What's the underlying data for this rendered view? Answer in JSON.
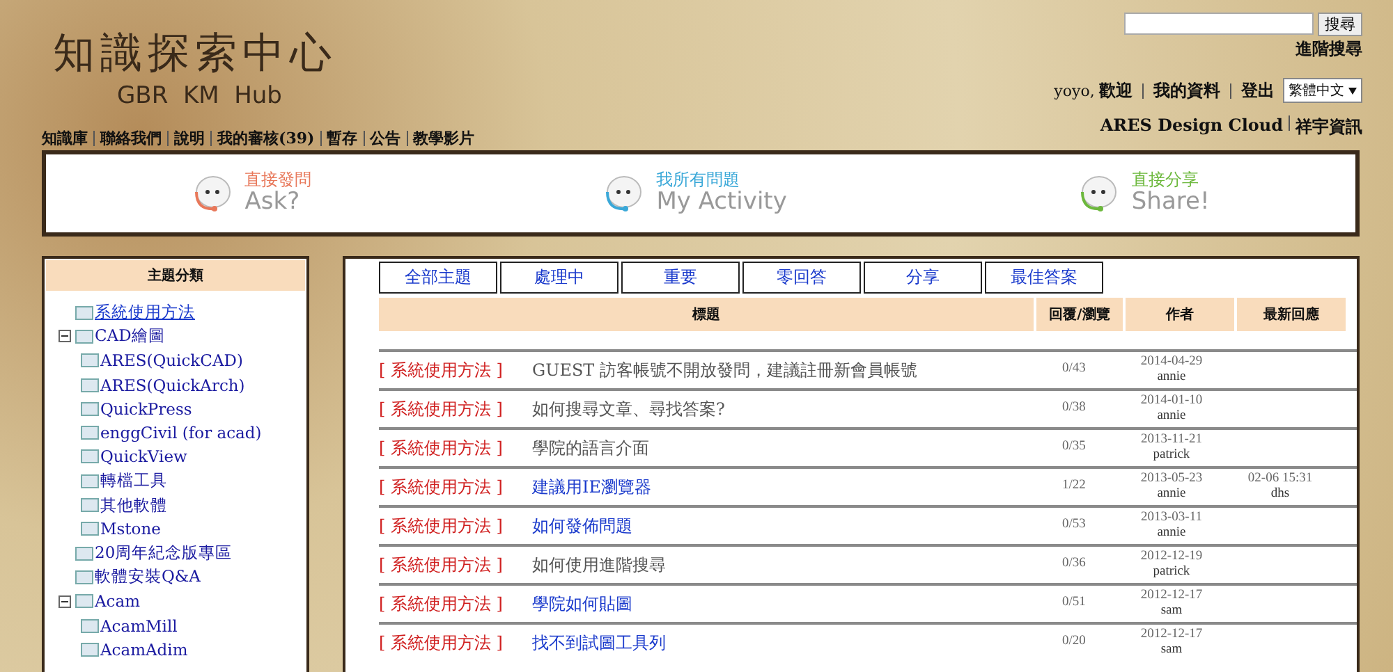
{
  "header": {
    "logo_title": "知識探索中心",
    "logo_subtitle": "GBR  KM  Hub"
  },
  "nav": [
    "知識庫",
    "聯絡我們",
    "說明",
    "我的審核(39)",
    "暫存",
    "公告",
    "教學影片"
  ],
  "search": {
    "button": "搜尋",
    "advanced": "進階搜尋"
  },
  "user": {
    "greeting": "yoyo, ",
    "welcome": "歡迎",
    "profile": "我的資料",
    "logout": "登出",
    "language": "繁體中文"
  },
  "footer_links": [
    "ARES Design Cloud",
    "祥宇資訊"
  ],
  "banner": [
    {
      "label": "直接發問",
      "english": "Ask?",
      "color": "#e8785a"
    },
    {
      "label": "我所有問題",
      "english": "My Activity",
      "color": "#3aa8d8"
    },
    {
      "label": "直接分享",
      "english": "Share!",
      "color": "#6cb83c"
    }
  ],
  "sidebar": {
    "title": "主題分類",
    "items": [
      {
        "label": "系統使用方法",
        "selected": true
      },
      {
        "label": "CAD繪圖",
        "selected": false,
        "expanded": true,
        "children": [
          {
            "label": "ARES(QuickCAD)",
            "selected": false
          },
          {
            "label": "ARES(QuickArch)",
            "selected": false
          },
          {
            "label": "QuickPress",
            "selected": false
          },
          {
            "label": "enggCivil (for acad)",
            "selected": false
          },
          {
            "label": "QuickView",
            "selected": false
          },
          {
            "label": "轉檔工具",
            "selected": false
          },
          {
            "label": "其他軟體",
            "selected": false
          },
          {
            "label": "Mstone",
            "selected": false
          }
        ]
      },
      {
        "label": "20周年紀念版專區",
        "selected": false
      },
      {
        "label": "軟體安裝Q&A",
        "selected": false
      },
      {
        "label": "Acam",
        "selected": false,
        "expanded": true,
        "children": [
          {
            "label": "AcamMill",
            "selected": false
          },
          {
            "label": "AcamAdim",
            "selected": false
          }
        ]
      }
    ]
  },
  "tabs": [
    "全部主題",
    "處理中",
    "重要",
    "零回答",
    "分享",
    "最佳答案"
  ],
  "table": {
    "columns": [
      "標題",
      "回覆/瀏覽",
      "作者",
      "最新回應"
    ],
    "rows": [
      {
        "category": "[ 系統使用方法 ]",
        "title": "GUEST 訪客帳號不開放發問，建議註冊新會員帳號",
        "visited": true,
        "replies": "0/43",
        "date": "2014-04-29",
        "author": "annie"
      },
      {
        "category": "[ 系統使用方法 ]",
        "title": "如何搜尋文章、尋找答案?",
        "visited": true,
        "replies": "0/38",
        "date": "2014-01-10",
        "author": "annie"
      },
      {
        "category": "[ 系統使用方法 ]",
        "title": "學院的語言介面",
        "visited": true,
        "replies": "0/35",
        "date": "2013-11-21",
        "author": "patrick"
      },
      {
        "category": "[ 系統使用方法 ]",
        "title": "建議用IE瀏覽器",
        "visited": false,
        "replies": "1/22",
        "date": "2013-05-23",
        "author": "annie",
        "latest_time": "02-06 15:31",
        "latest_author": "dhs"
      },
      {
        "category": "[ 系統使用方法 ]",
        "title": "如何發佈問題",
        "visited": false,
        "replies": "0/53",
        "date": "2013-03-11",
        "author": "annie"
      },
      {
        "category": "[ 系統使用方法 ]",
        "title": "如何使用進階搜尋",
        "visited": true,
        "replies": "0/36",
        "date": "2012-12-19",
        "author": "patrick"
      },
      {
        "category": "[ 系統使用方法 ]",
        "title": "學院如何貼圖",
        "visited": false,
        "replies": "0/51",
        "date": "2012-12-17",
        "author": "sam"
      },
      {
        "category": "[ 系統使用方法 ]",
        "title": "找不到試圖工具列",
        "visited": false,
        "replies": "0/20",
        "date": "2012-12-17",
        "author": "sam"
      }
    ]
  }
}
